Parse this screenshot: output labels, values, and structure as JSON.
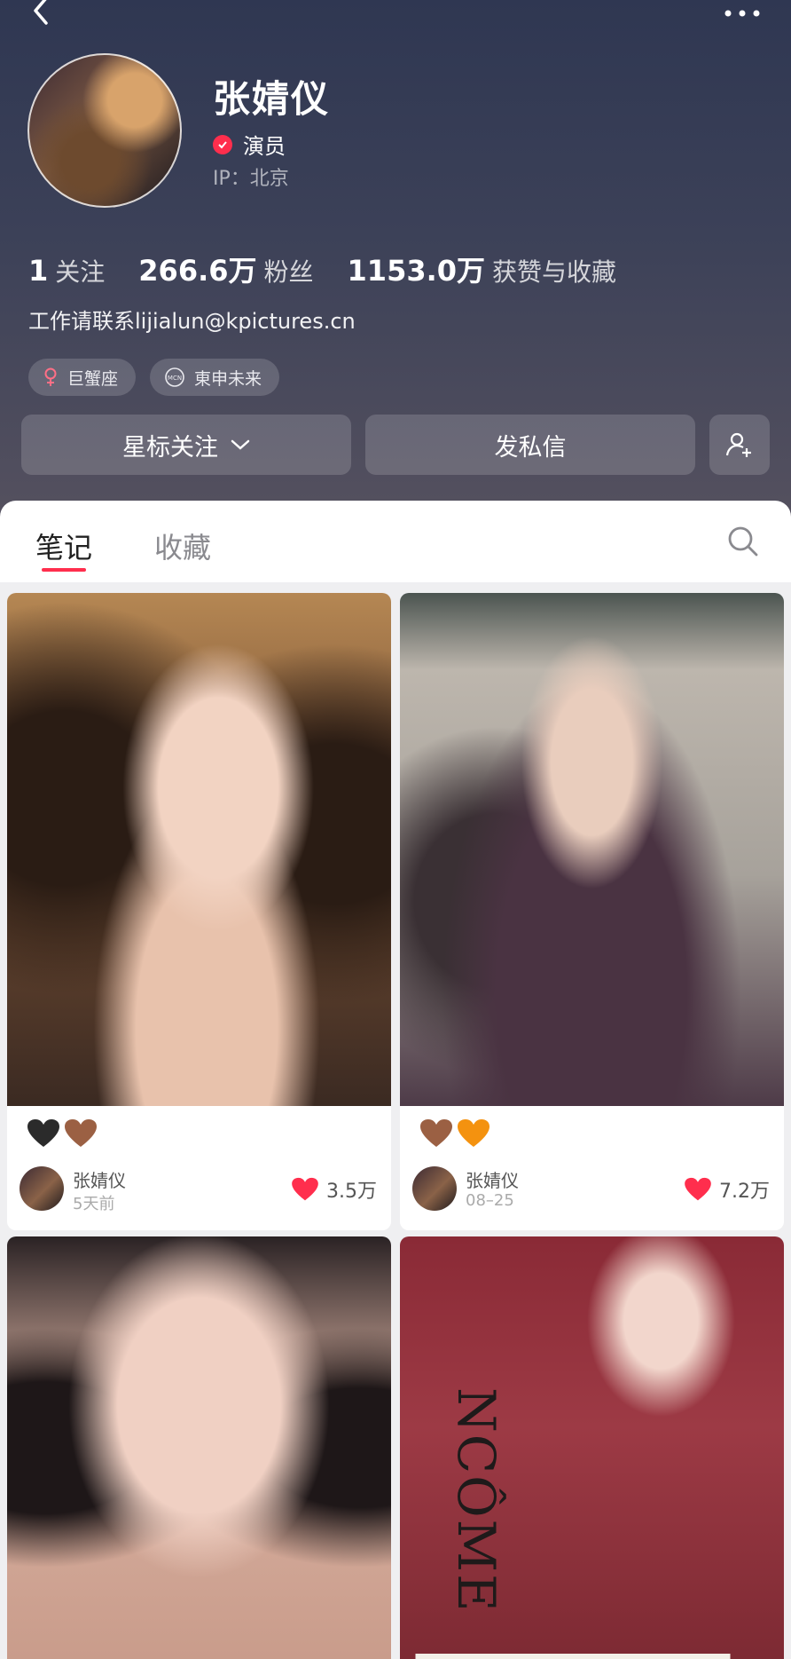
{
  "profile": {
    "name": "张婧仪",
    "title": "演员",
    "ip": "IP：北京",
    "bio": "工作请联系lijialun@kpictures.cn"
  },
  "stats": [
    {
      "value": "1",
      "label": "关注"
    },
    {
      "value": "266.6万",
      "label": "粉丝"
    },
    {
      "value": "1153.0万",
      "label": "获赞与收藏"
    }
  ],
  "tags": [
    {
      "label": "巨蟹座",
      "icon": "female-icon"
    },
    {
      "label": "東申未来",
      "icon": "mcn-icon"
    }
  ],
  "actions": {
    "follow": "星标关注",
    "message": "发私信",
    "add_friend_icon": "add-user-icon"
  },
  "tabs": {
    "notes": "笔记",
    "favorites": "收藏"
  },
  "notes": [
    {
      "emoji": "🖤🤎",
      "author": "张婧仪",
      "date": "5天前",
      "likes": "3.5万"
    },
    {
      "emoji": "🤎🧡",
      "author": "张婧仪",
      "date": "08–25",
      "likes": "7.2万"
    },
    {
      "emoji": "",
      "author": "",
      "date": "",
      "likes": ""
    },
    {
      "emoji": "",
      "author": "",
      "date": "",
      "likes": "",
      "poster_text": "NCÔME"
    }
  ],
  "colors": {
    "accent": "#ff2e4d",
    "header_top": "#2f3752",
    "header_bottom": "#55515f"
  }
}
